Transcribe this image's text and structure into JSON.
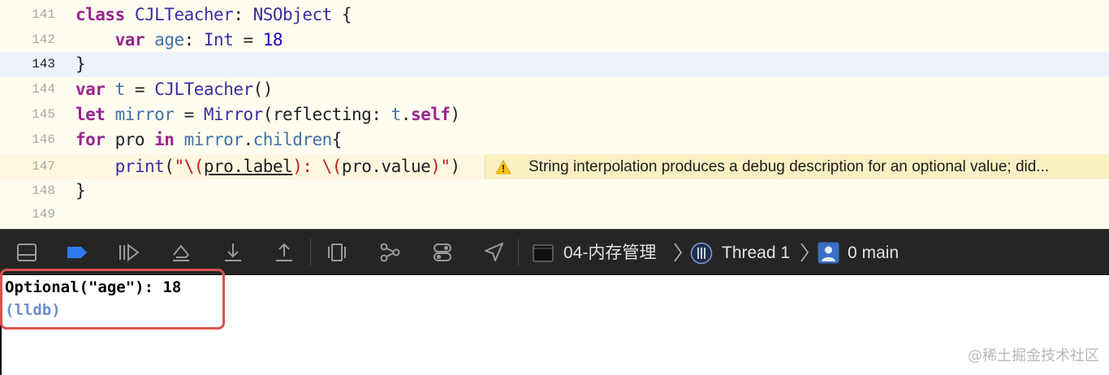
{
  "editor": {
    "lines": [
      {
        "number": "141",
        "tokens": {
          "kw1": "class",
          "name": "CJLTeacher",
          "colon": ": ",
          "super": "NSObject",
          "brace": " {"
        }
      },
      {
        "number": "142",
        "tokens": {
          "indent": "    ",
          "kw1": "var",
          "sp": " ",
          "name": "age",
          "colon": ": ",
          "type": "Int",
          "eq": " = ",
          "num": "18"
        }
      },
      {
        "number": "143",
        "tokens": {
          "text": "}"
        }
      },
      {
        "number": "144",
        "tokens": {
          "kw1": "var",
          "sp": " ",
          "name": "t",
          "eq": " = ",
          "type": "CJLTeacher",
          "rest": "()"
        }
      },
      {
        "number": "145",
        "tokens": {
          "kw1": "let",
          "sp": " ",
          "name": "mirror",
          "eq": " = ",
          "type": "Mirror",
          "rest1": "(reflecting: ",
          "obj": "t",
          "dot": ".",
          "kw2": "self",
          "rest2": ")"
        }
      },
      {
        "number": "146",
        "tokens": {
          "kw1": "for",
          "sp1": " pro ",
          "kw2": "in",
          "sp2": " ",
          "obj": "mirror",
          "dot": ".",
          "prop": "children",
          "rest": "{"
        }
      },
      {
        "number": "147",
        "tokens": {
          "indent": "    ",
          "fn": "print",
          "open": "(",
          "s1": "\"\\(",
          "a": "pro",
          "d1": ".",
          "b": "label",
          "s2": "): \\(",
          "c": "pro",
          "d2": ".",
          "e": "value",
          "s3": ")\"",
          "close": ")"
        }
      },
      {
        "number": "148",
        "tokens": {
          "text": "}"
        }
      },
      {
        "number": "149",
        "tokens": {
          "text": ""
        }
      }
    ],
    "warning": {
      "icon": "warning-triangle-icon",
      "message": "String interpolation produces a debug description for an optional value; did..."
    }
  },
  "debugbar": {
    "buttons": [
      {
        "name": "hide-debug-area-icon"
      },
      {
        "name": "breakpoints-toggle-icon"
      },
      {
        "name": "continue-icon"
      },
      {
        "name": "step-over-icon"
      },
      {
        "name": "step-into-icon"
      },
      {
        "name": "step-out-icon"
      },
      {
        "name": "view-hierarchy-icon"
      },
      {
        "name": "memory-graph-icon"
      },
      {
        "name": "environment-overrides-icon"
      },
      {
        "name": "simulate-location-icon"
      }
    ],
    "breadcrumb": {
      "target": "04-内存管理",
      "thread": "Thread 1",
      "frame": "0 main"
    }
  },
  "console": {
    "output": "Optional(\"age\"): 18",
    "prompt": "(lldb)"
  },
  "watermark": "@稀土掘金技术社区",
  "colors": {
    "keyword": "#9b2393",
    "type": "#3b2ba3",
    "number": "#1c00cf",
    "string": "#c41a16",
    "warning_bg": "#fbefc4",
    "highlight_border": "#d9534f"
  }
}
